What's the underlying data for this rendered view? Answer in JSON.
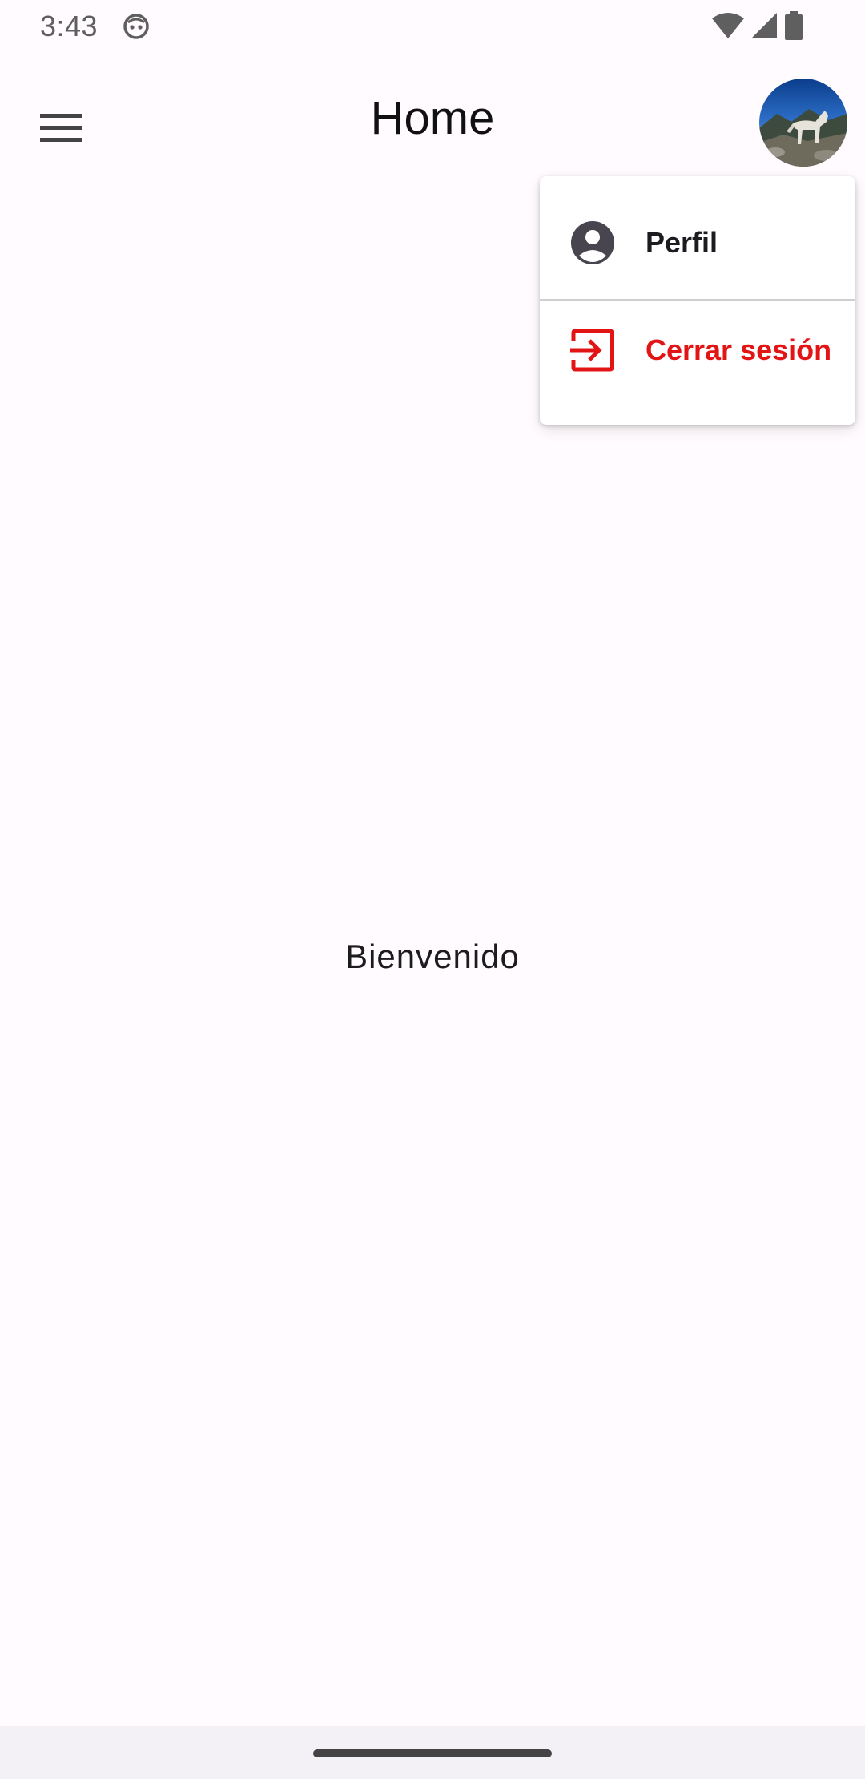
{
  "status_bar": {
    "time": "3:43",
    "app_icon": "android-face-icon",
    "icons": [
      "wifi-icon",
      "cell-signal-icon",
      "battery-icon"
    ]
  },
  "app_bar": {
    "menu_icon": "hamburger-menu-icon",
    "title": "Home",
    "avatar_icon": "user-avatar-photo"
  },
  "menu": {
    "items": [
      {
        "label": "Perfil",
        "icon": "account-circle-icon",
        "color": "#1c1b1f"
      },
      {
        "label": "Cerrar sesión",
        "icon": "logout-icon",
        "color": "#e31414"
      }
    ]
  },
  "content": {
    "welcome_text": "Bienvenido"
  },
  "colors": {
    "background": "#fffbfe",
    "danger": "#e31414",
    "text": "#1c1b1f"
  }
}
